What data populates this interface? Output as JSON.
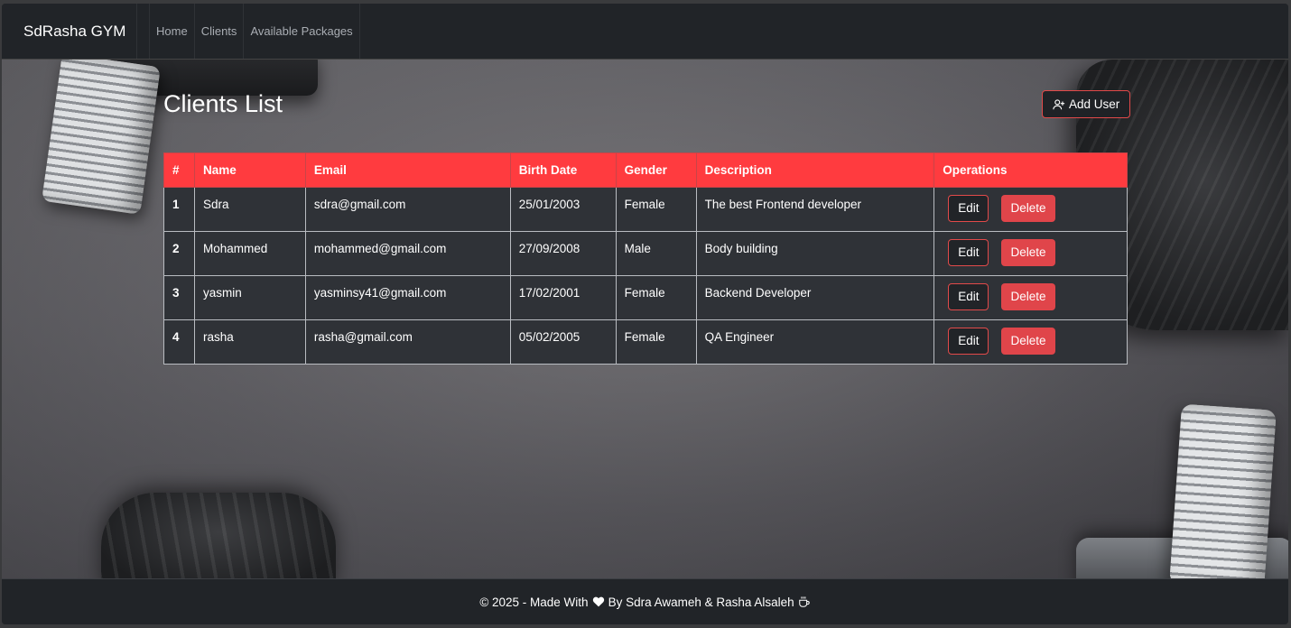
{
  "navbar": {
    "brand": "SdRasha GYM",
    "links": [
      {
        "label": "Home"
      },
      {
        "label": "Clients"
      },
      {
        "label": "Available Packages"
      }
    ]
  },
  "page": {
    "title": "Clients List",
    "add_user_label": "Add User"
  },
  "table": {
    "headers": [
      "#",
      "Name",
      "Email",
      "Birth Date",
      "Gender",
      "Description",
      "Operations"
    ],
    "rows": [
      {
        "num": "1",
        "name": "Sdra",
        "email": "sdra@gmail.com",
        "birth": "25/01/2003",
        "gender": "Female",
        "desc": "The best Frontend developer"
      },
      {
        "num": "2",
        "name": "Mohammed",
        "email": "mohammed@gmail.com",
        "birth": "27/09/2008",
        "gender": "Male",
        "desc": "Body building"
      },
      {
        "num": "3",
        "name": "yasmin",
        "email": "yasminsy41@gmail.com",
        "birth": "17/02/2001",
        "gender": "Female",
        "desc": "Backend Developer"
      },
      {
        "num": "4",
        "name": "rasha",
        "email": "rasha@gmail.com",
        "birth": "05/02/2005",
        "gender": "Female",
        "desc": "QA Engineer"
      }
    ],
    "edit_label": "Edit",
    "delete_label": "Delete"
  },
  "footer": {
    "prefix": "© 2025 - Made With",
    "suffix": "By Sdra Awameh & Rasha Alsaleh",
    "heart_icon": "heart-icon",
    "coffee_icon": "coffee-icon"
  },
  "colors": {
    "accent": "#ff3b3f",
    "delete": "#e0454a",
    "dark": "#212428",
    "row": "#2f3237"
  }
}
